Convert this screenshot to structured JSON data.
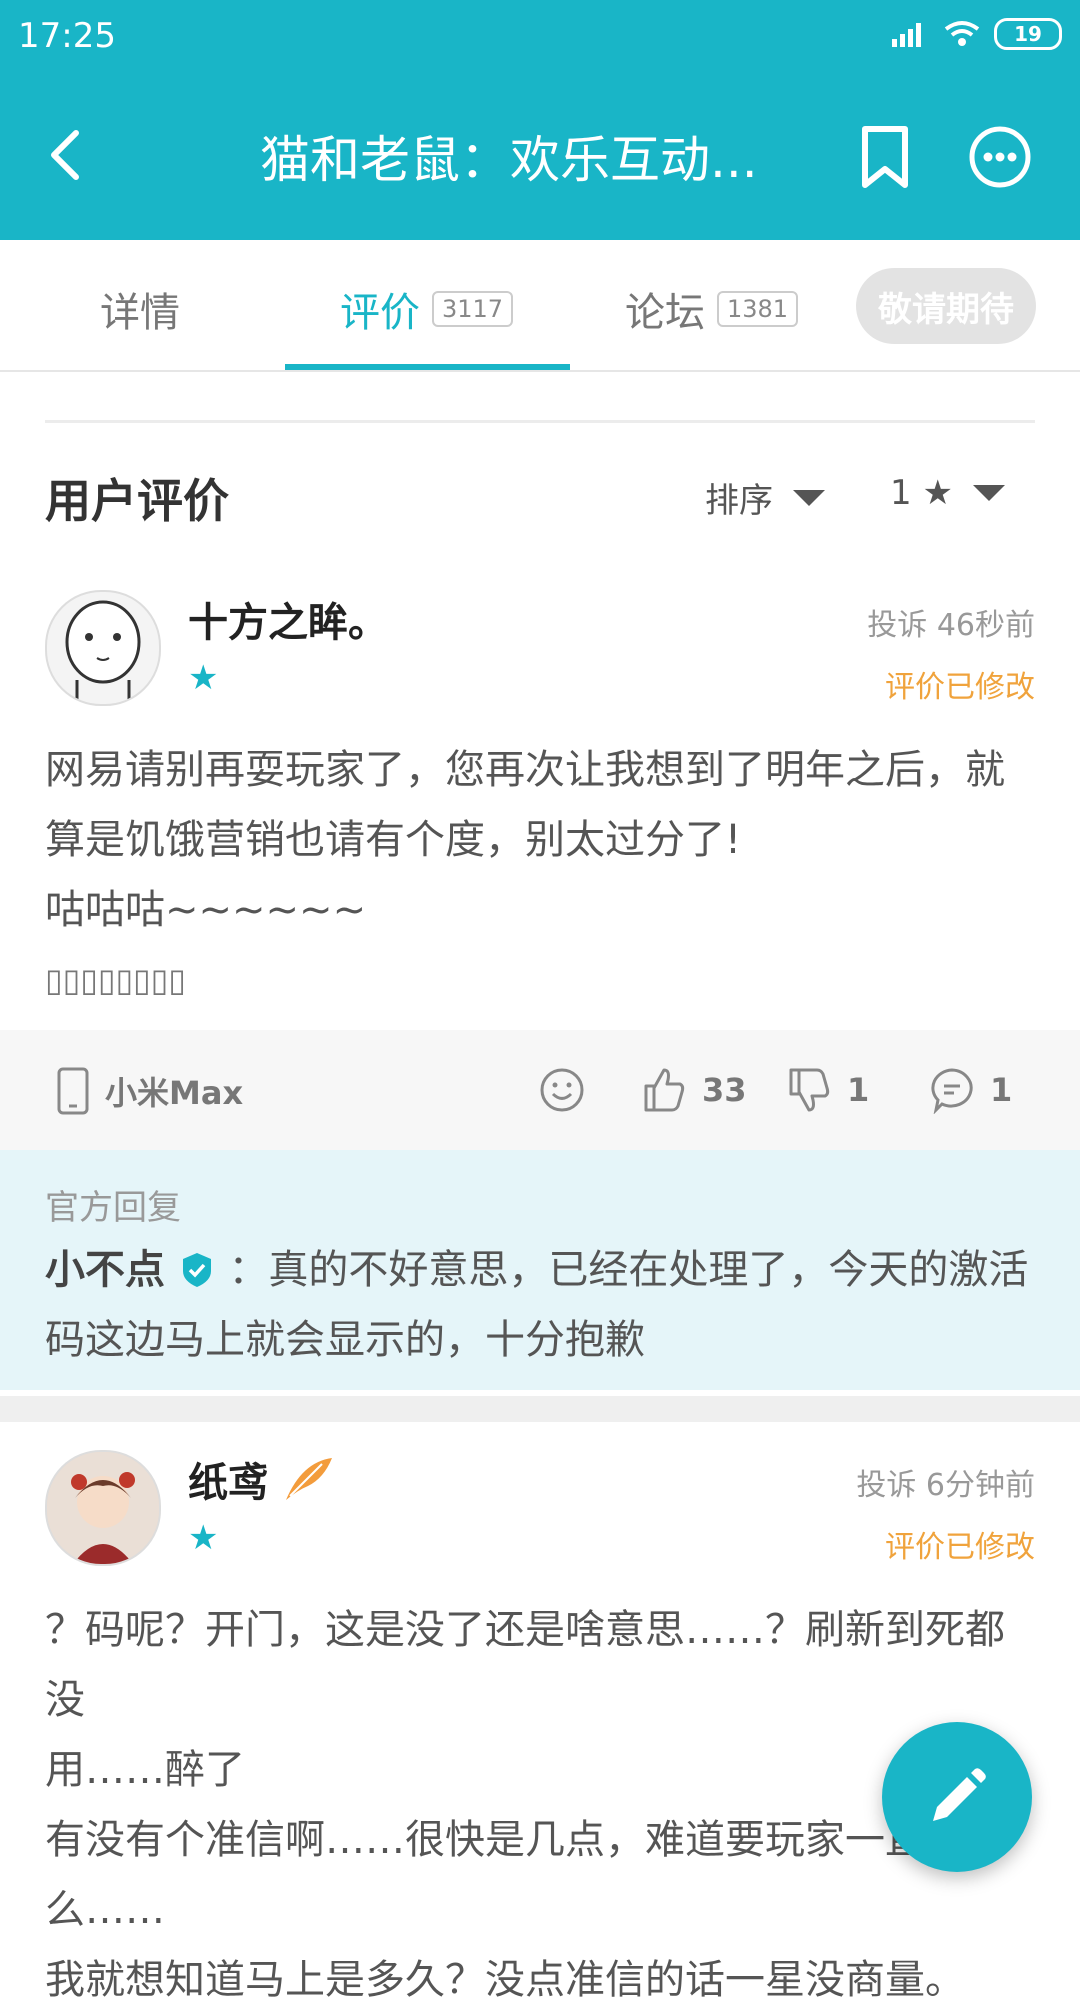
{
  "status": {
    "time": "17:25",
    "battery": "19"
  },
  "header": {
    "title": "猫和老鼠：欢乐互动..."
  },
  "tabs": [
    {
      "label": "详情"
    },
    {
      "label": "评价",
      "count": "3117"
    },
    {
      "label": "论坛",
      "count": "1381"
    }
  ],
  "await_button": "敬请期待",
  "section": {
    "title": "用户评价",
    "sort_label": "排序",
    "rating_filter": "1 ★"
  },
  "reviews": [
    {
      "username": "十方之眸。",
      "report": "投诉",
      "time": "46秒前",
      "modified": "评价已修改",
      "body": [
        "网易请别再耍玩家了，您再次让我想到了明年之后，就",
        "算是饥饿营销也请有个度，别太过分了!",
        "咕咕咕~~~~~~",
        "▯▯▯▯▯▯▯▯"
      ],
      "device": "小米Max",
      "likes": "33",
      "dislikes": "1",
      "comments": "1",
      "official_label": "官方回复",
      "official_name": "小不点",
      "official_reply": "：真的不好意思，已经在处理了，今天的激活码这边马上就会显示的，十分抱歉"
    },
    {
      "username": "纸鸢",
      "report": "投诉",
      "time": "6分钟前",
      "modified": "评价已修改",
      "body": [
        "？码呢？开门，这是没了还是啥意思……？刷新到死都没",
        "用……醉了",
        "有没有个准信啊……很快是几点，难道要玩家一直刷",
        "么……",
        "我就想知道马上是多久？没点准信的话一星没商量。"
      ]
    }
  ],
  "colors": {
    "accent": "#19b5c7",
    "modified": "#f0a33c"
  }
}
